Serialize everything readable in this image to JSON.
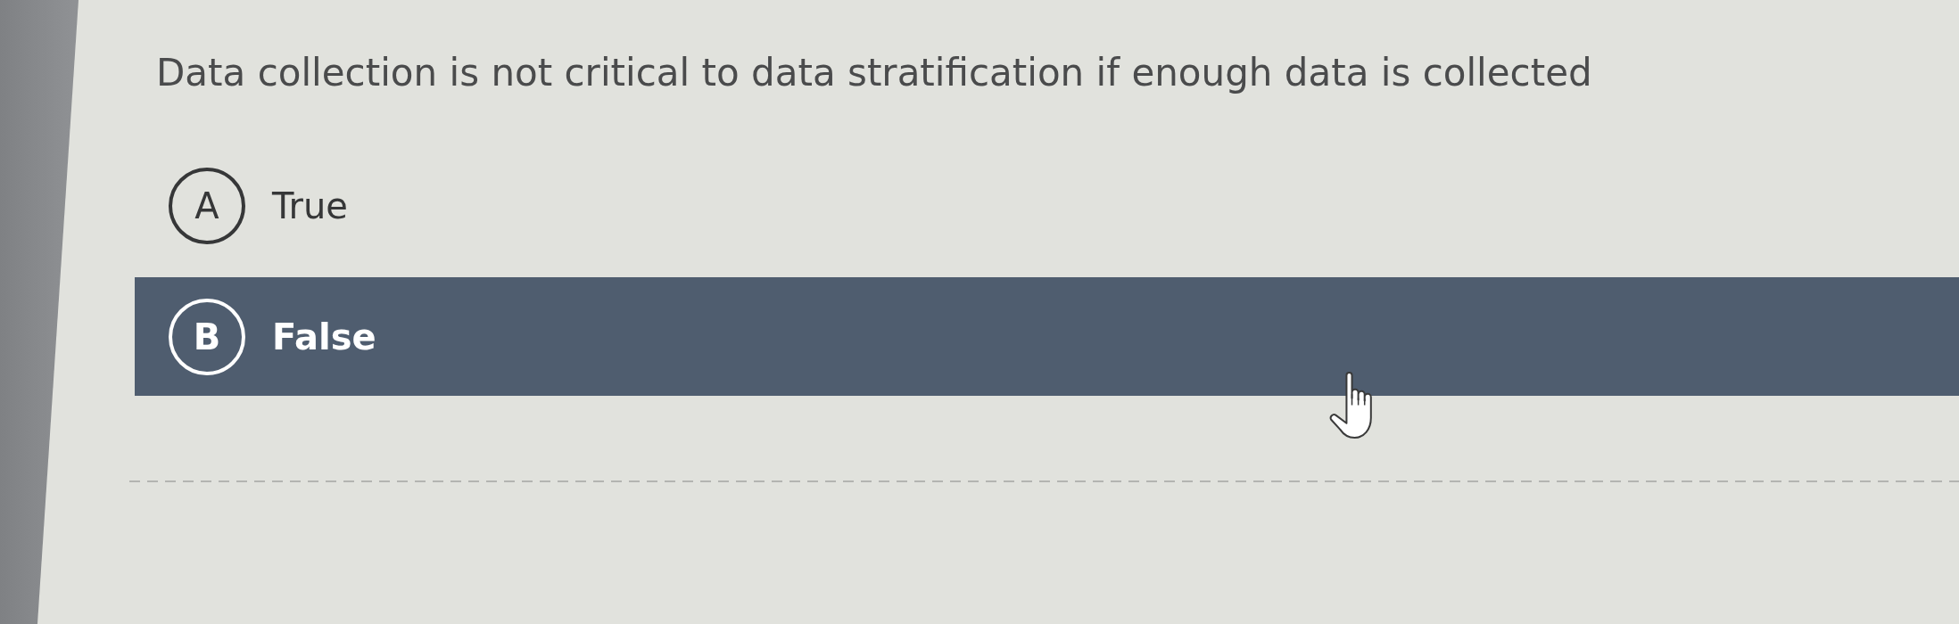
{
  "question": {
    "text": "Data collection is not critical to data stratification if enough data is collected"
  },
  "options": [
    {
      "letter": "A",
      "label": "True",
      "selected": false
    },
    {
      "letter": "B",
      "label": "False",
      "selected": true
    }
  ]
}
